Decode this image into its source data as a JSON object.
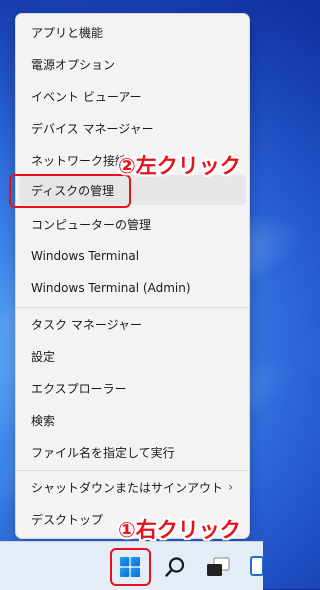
{
  "menu": {
    "items": [
      {
        "label": "アプリと機能"
      },
      {
        "label": "電源オプション"
      },
      {
        "label": "イベント ビューアー"
      },
      {
        "label": "デバイス マネージャー"
      },
      {
        "label": "ネットワーク接続"
      },
      {
        "label": "ディスクの管理"
      },
      {
        "label": "コンピューターの管理"
      },
      {
        "label": "Windows Terminal"
      },
      {
        "label": "Windows Terminal (Admin)"
      },
      {
        "label": "タスク マネージャー"
      },
      {
        "label": "設定"
      },
      {
        "label": "エクスプローラー"
      },
      {
        "label": "検索"
      },
      {
        "label": "ファイル名を指定して実行"
      },
      {
        "label": "シャットダウンまたはサインアウト"
      },
      {
        "label": "デスクトップ"
      }
    ],
    "submenu_icon": "chevron-right-icon"
  },
  "annotations": {
    "step1": "①右クリック",
    "step2": "②左クリック",
    "color": "#e8101a"
  },
  "taskbar": {
    "icons": [
      "windows-start-icon",
      "search-icon",
      "task-view-icon",
      "edge-icon"
    ]
  }
}
